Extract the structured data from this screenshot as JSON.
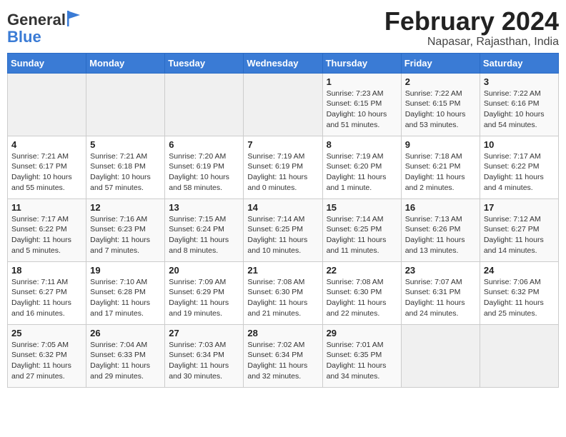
{
  "header": {
    "logo_line1": "General",
    "logo_line2": "Blue",
    "title": "February 2024",
    "subtitle": "Napasar, Rajasthan, India"
  },
  "weekdays": [
    "Sunday",
    "Monday",
    "Tuesday",
    "Wednesday",
    "Thursday",
    "Friday",
    "Saturday"
  ],
  "weeks": [
    [
      {
        "day": "",
        "info": ""
      },
      {
        "day": "",
        "info": ""
      },
      {
        "day": "",
        "info": ""
      },
      {
        "day": "",
        "info": ""
      },
      {
        "day": "1",
        "info": "Sunrise: 7:23 AM\nSunset: 6:15 PM\nDaylight: 10 hours and 51 minutes."
      },
      {
        "day": "2",
        "info": "Sunrise: 7:22 AM\nSunset: 6:15 PM\nDaylight: 10 hours and 53 minutes."
      },
      {
        "day": "3",
        "info": "Sunrise: 7:22 AM\nSunset: 6:16 PM\nDaylight: 10 hours and 54 minutes."
      }
    ],
    [
      {
        "day": "4",
        "info": "Sunrise: 7:21 AM\nSunset: 6:17 PM\nDaylight: 10 hours and 55 minutes."
      },
      {
        "day": "5",
        "info": "Sunrise: 7:21 AM\nSunset: 6:18 PM\nDaylight: 10 hours and 57 minutes."
      },
      {
        "day": "6",
        "info": "Sunrise: 7:20 AM\nSunset: 6:19 PM\nDaylight: 10 hours and 58 minutes."
      },
      {
        "day": "7",
        "info": "Sunrise: 7:19 AM\nSunset: 6:19 PM\nDaylight: 11 hours and 0 minutes."
      },
      {
        "day": "8",
        "info": "Sunrise: 7:19 AM\nSunset: 6:20 PM\nDaylight: 11 hours and 1 minute."
      },
      {
        "day": "9",
        "info": "Sunrise: 7:18 AM\nSunset: 6:21 PM\nDaylight: 11 hours and 2 minutes."
      },
      {
        "day": "10",
        "info": "Sunrise: 7:17 AM\nSunset: 6:22 PM\nDaylight: 11 hours and 4 minutes."
      }
    ],
    [
      {
        "day": "11",
        "info": "Sunrise: 7:17 AM\nSunset: 6:22 PM\nDaylight: 11 hours and 5 minutes."
      },
      {
        "day": "12",
        "info": "Sunrise: 7:16 AM\nSunset: 6:23 PM\nDaylight: 11 hours and 7 minutes."
      },
      {
        "day": "13",
        "info": "Sunrise: 7:15 AM\nSunset: 6:24 PM\nDaylight: 11 hours and 8 minutes."
      },
      {
        "day": "14",
        "info": "Sunrise: 7:14 AM\nSunset: 6:25 PM\nDaylight: 11 hours and 10 minutes."
      },
      {
        "day": "15",
        "info": "Sunrise: 7:14 AM\nSunset: 6:25 PM\nDaylight: 11 hours and 11 minutes."
      },
      {
        "day": "16",
        "info": "Sunrise: 7:13 AM\nSunset: 6:26 PM\nDaylight: 11 hours and 13 minutes."
      },
      {
        "day": "17",
        "info": "Sunrise: 7:12 AM\nSunset: 6:27 PM\nDaylight: 11 hours and 14 minutes."
      }
    ],
    [
      {
        "day": "18",
        "info": "Sunrise: 7:11 AM\nSunset: 6:27 PM\nDaylight: 11 hours and 16 minutes."
      },
      {
        "day": "19",
        "info": "Sunrise: 7:10 AM\nSunset: 6:28 PM\nDaylight: 11 hours and 17 minutes."
      },
      {
        "day": "20",
        "info": "Sunrise: 7:09 AM\nSunset: 6:29 PM\nDaylight: 11 hours and 19 minutes."
      },
      {
        "day": "21",
        "info": "Sunrise: 7:08 AM\nSunset: 6:30 PM\nDaylight: 11 hours and 21 minutes."
      },
      {
        "day": "22",
        "info": "Sunrise: 7:08 AM\nSunset: 6:30 PM\nDaylight: 11 hours and 22 minutes."
      },
      {
        "day": "23",
        "info": "Sunrise: 7:07 AM\nSunset: 6:31 PM\nDaylight: 11 hours and 24 minutes."
      },
      {
        "day": "24",
        "info": "Sunrise: 7:06 AM\nSunset: 6:32 PM\nDaylight: 11 hours and 25 minutes."
      }
    ],
    [
      {
        "day": "25",
        "info": "Sunrise: 7:05 AM\nSunset: 6:32 PM\nDaylight: 11 hours and 27 minutes."
      },
      {
        "day": "26",
        "info": "Sunrise: 7:04 AM\nSunset: 6:33 PM\nDaylight: 11 hours and 29 minutes."
      },
      {
        "day": "27",
        "info": "Sunrise: 7:03 AM\nSunset: 6:34 PM\nDaylight: 11 hours and 30 minutes."
      },
      {
        "day": "28",
        "info": "Sunrise: 7:02 AM\nSunset: 6:34 PM\nDaylight: 11 hours and 32 minutes."
      },
      {
        "day": "29",
        "info": "Sunrise: 7:01 AM\nSunset: 6:35 PM\nDaylight: 11 hours and 34 minutes."
      },
      {
        "day": "",
        "info": ""
      },
      {
        "day": "",
        "info": ""
      }
    ]
  ]
}
